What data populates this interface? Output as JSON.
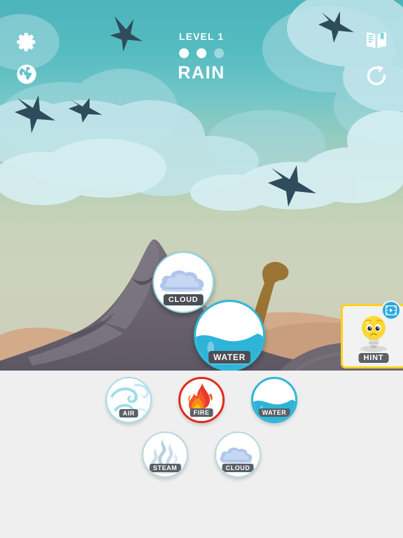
{
  "header": {
    "level_label": "LEVEL 1",
    "goal_label": "RAIN",
    "progress_total": 3,
    "progress_filled": 2
  },
  "hud": {
    "settings": {
      "name": "settings",
      "icon": "gear-icon"
    },
    "language": {
      "name": "language",
      "icon": "globe-icon"
    },
    "encyclopedia": {
      "name": "encyclopedia",
      "icon": "book-icon"
    },
    "restart": {
      "name": "restart",
      "icon": "refresh-icon"
    }
  },
  "hint": {
    "label": "HINT",
    "icon": "lightbulb-sad-icon",
    "badge_icon": "video-play-icon"
  },
  "field": {
    "items": [
      {
        "label": "CLOUD",
        "icon": "cloud-icon"
      },
      {
        "label": "WATER",
        "icon": "wave-icon"
      }
    ]
  },
  "tray": {
    "row1": [
      {
        "label": "AIR",
        "icon": "air-swirl-icon",
        "ring": "#a8dce8"
      },
      {
        "label": "FIRE",
        "icon": "flame-icon",
        "ring": "#e02b18"
      },
      {
        "label": "WATER",
        "icon": "wave-icon",
        "ring": "#2fb6d8"
      }
    ],
    "row2": [
      {
        "label": "STEAM",
        "icon": "steam-icon",
        "ring": "#bcd6de"
      },
      {
        "label": "CLOUD",
        "icon": "cloud-icon",
        "ring": "#b7d9e3"
      }
    ]
  },
  "colors": {
    "sky_top": "#4cb4bb",
    "sky_bottom": "#ccd0ba",
    "tray_bg": "#efefef",
    "hint_border": "#ffd11a",
    "label_pill": "#5b6066",
    "mountain": "#6b6570",
    "sand": "#d3ab8b",
    "dino": "#9a7432"
  }
}
